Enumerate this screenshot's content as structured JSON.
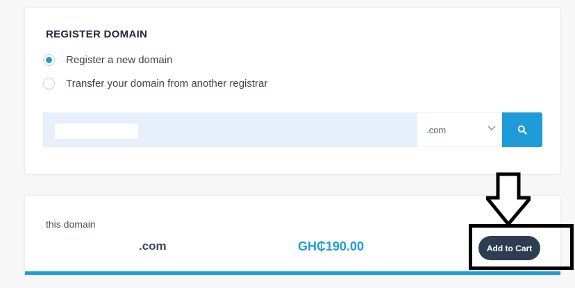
{
  "register": {
    "title": "REGISTER DOMAIN",
    "options": [
      {
        "label": "Register a new domain",
        "checked": true
      },
      {
        "label": "Transfer your domain from another registrar",
        "checked": false
      }
    ],
    "search": {
      "input_value": "",
      "tld_selected": ".com",
      "button_icon": "search-icon"
    }
  },
  "result": {
    "label": "this domain",
    "tld": ".com",
    "price": "GH₵190.00",
    "add_to_cart_label": "Add to Cart"
  },
  "annotation": {
    "arrow_icon": "down-arrow-icon",
    "highlight_color": "#000000"
  },
  "colors": {
    "accent": "#1e9cd7",
    "button_dark": "#2d3e50",
    "input_bg": "#e7effa"
  }
}
